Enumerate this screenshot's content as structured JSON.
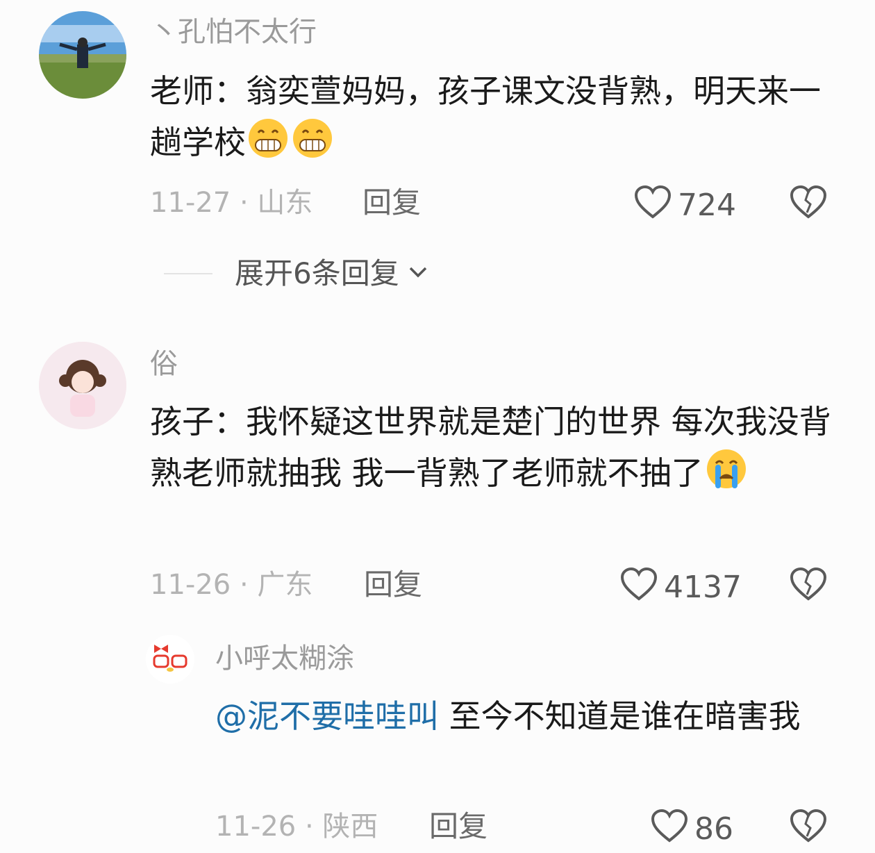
{
  "comments": [
    {
      "username": "丶孔怕不太行",
      "text_prefix": "老师：翁奕萱妈妈，孩子课文没背熟，明天来一趟学校",
      "emoji": "grin-icon",
      "emoji_count": 2,
      "date": "11-27",
      "location": "山东",
      "reply_label": "回复",
      "likes": "724",
      "expand_label": "展开6条回复"
    },
    {
      "username": "俗",
      "text": "孩子：我怀疑这世界就是楚门的世界 每次我没背熟老师就抽我 我一背熟了老师就不抽了",
      "emoji": "crying-icon",
      "date": "11-26",
      "location": "广东",
      "reply_label": "回复",
      "likes": "4137"
    }
  ],
  "reply": {
    "username": "小呼太糊涂",
    "mention": "@泥不要哇哇叫",
    "text": " 至今不知道是谁在暗害我",
    "date": "11-26",
    "location": "陕西",
    "reply_label": "回复",
    "likes": "86"
  },
  "colors": {
    "mention": "#1f6ea8",
    "muted": "#b3b3b3",
    "username": "#9a9a9a"
  }
}
